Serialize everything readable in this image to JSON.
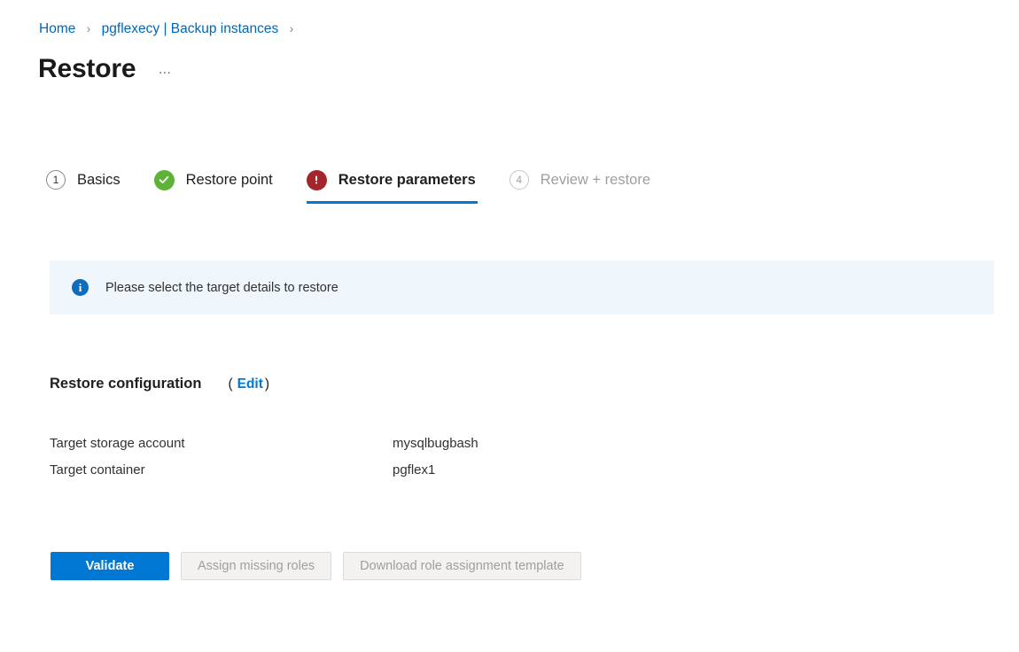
{
  "breadcrumb": {
    "items": [
      {
        "label": "Home"
      },
      {
        "label": "pgflexecy | Backup instances"
      }
    ],
    "separator": "›"
  },
  "header": {
    "title": "Restore",
    "more_label": "…"
  },
  "wizard": {
    "tabs": [
      {
        "label": "Basics",
        "badge": "1",
        "state": "pending"
      },
      {
        "label": "Restore point",
        "badge": "check",
        "state": "complete"
      },
      {
        "label": "Restore parameters",
        "badge": "error",
        "state": "active"
      },
      {
        "label": "Review + restore",
        "badge": "4",
        "state": "disabled"
      }
    ]
  },
  "info_banner": {
    "icon": "info-icon",
    "icon_glyph": "i",
    "message": "Please select the target details to restore"
  },
  "restore_configuration": {
    "title": "Restore configuration",
    "paren_open": "(",
    "edit_label": "Edit",
    "paren_close": ")",
    "rows": [
      {
        "label": "Target storage account",
        "value": "mysqlbugbash"
      },
      {
        "label": "Target container",
        "value": "pgflex1"
      }
    ]
  },
  "actions": {
    "validate_label": "Validate",
    "assign_roles_label": "Assign missing roles",
    "download_template_label": "Download role assignment template"
  },
  "colors": {
    "accent": "#0078d4",
    "link": "#0067b8",
    "success": "#5cb335",
    "error": "#a4262c",
    "info_bg": "#eff6fc",
    "info_icon": "#0f6cbd",
    "disabled_bg": "#f3f2f1",
    "disabled_text": "#a19f9d"
  }
}
